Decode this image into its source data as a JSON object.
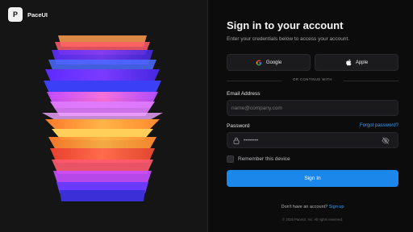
{
  "brand": {
    "logo_letter": "P",
    "name": "PaceUI"
  },
  "auth": {
    "title": "Sign in to your account",
    "subtitle": "Enter your credentials below to access your account.",
    "social": {
      "google_label": "Google",
      "apple_label": "Apple"
    },
    "divider_text": "OR CONTINUE WITH",
    "email": {
      "label": "Email Address",
      "placeholder": "name@company.com",
      "value": ""
    },
    "password": {
      "label": "Password",
      "forgot_label": "Forgot password?",
      "masked_value": "••••••••"
    },
    "remember_label": "Remember this device",
    "remember_checked": false,
    "submit_label": "Sign In",
    "signup": {
      "prompt": "Don't have an account?",
      "link_label": "Sign up"
    },
    "copyright": "© 2026 PaceUI, Inc. All rights reserved."
  },
  "colors": {
    "accent": "#1b87ea",
    "link": "#3b9cf2",
    "background": "#0c0c0d",
    "panel": "#151516"
  },
  "icons": {
    "google": "google-logo-icon",
    "apple": "apple-logo-icon",
    "lock": "lock-icon",
    "eye": "eye-off-icon"
  }
}
